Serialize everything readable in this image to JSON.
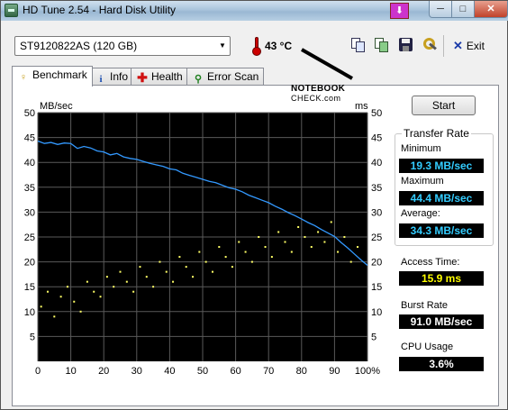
{
  "window": {
    "title": "HD Tune 2.54 - Hard Disk Utility",
    "min_glyph": "─",
    "max_glyph": "□",
    "close_glyph": "✕",
    "pin_glyph": "⬇"
  },
  "toolbar": {
    "drive": "ST9120822AS (120 GB)",
    "temperature": "43 °C",
    "exit_label": "Exit"
  },
  "watermark": {
    "line1": "NOTEBOOK",
    "line2": "CHECK.com"
  },
  "tabs": [
    {
      "label": "Benchmark",
      "icon": "benchmark-icon",
      "active": true
    },
    {
      "label": "Info",
      "icon": "info-icon"
    },
    {
      "label": "Health",
      "icon": "health-icon"
    },
    {
      "label": "Error Scan",
      "icon": "error-scan-icon"
    }
  ],
  "benchmark": {
    "start_label": "Start",
    "transfer_rate_label": "Transfer Rate",
    "minimum_label": "Minimum",
    "minimum": "19.3 MB/sec",
    "maximum_label": "Maximum",
    "maximum": "44.4 MB/sec",
    "average_label": "Average:",
    "average": "34.3 MB/sec",
    "access_time_label": "Access Time:",
    "access_time": "15.9 ms",
    "burst_rate_label": "Burst Rate",
    "burst_rate": "91.0 MB/sec",
    "cpu_usage_label": "CPU Usage",
    "cpu_usage": "3.6%"
  },
  "chart_data": {
    "type": "line",
    "ylabel": "MB/sec",
    "y2label": "ms",
    "xlim": [
      0,
      100
    ],
    "ylim": [
      0,
      50
    ],
    "y2lim": [
      0,
      50
    ],
    "x_ticks": [
      "0",
      "10",
      "20",
      "30",
      "40",
      "50",
      "60",
      "70",
      "80",
      "90",
      "100%"
    ],
    "y_ticks": [
      5,
      10,
      15,
      20,
      25,
      30,
      35,
      40,
      45,
      50
    ],
    "grid": true,
    "background": "#000000",
    "series": [
      {
        "type": "line",
        "color": "#3399ff",
        "x": [
          0,
          2,
          4,
          6,
          8,
          10,
          12,
          14,
          16,
          18,
          20,
          22,
          24,
          26,
          28,
          30,
          32,
          34,
          36,
          38,
          40,
          42,
          44,
          46,
          48,
          50,
          52,
          54,
          56,
          58,
          60,
          62,
          64,
          66,
          68,
          70,
          72,
          74,
          76,
          78,
          80,
          82,
          84,
          86,
          88,
          90,
          92,
          94,
          96,
          98,
          100
        ],
        "y": [
          44.3,
          43.8,
          44.0,
          43.6,
          43.9,
          43.8,
          42.8,
          43.2,
          42.9,
          42.3,
          42.1,
          41.5,
          41.8,
          41.1,
          40.8,
          40.6,
          40.2,
          39.8,
          39.5,
          39.2,
          38.7,
          38.5,
          37.8,
          37.4,
          37.0,
          36.6,
          36.2,
          35.9,
          35.4,
          34.9,
          34.6,
          34.1,
          33.4,
          32.9,
          32.4,
          31.9,
          31.2,
          30.6,
          29.9,
          29.3,
          28.6,
          27.9,
          27.3,
          26.5,
          25.8,
          25.1,
          23.9,
          22.8,
          21.6,
          20.4,
          19.3
        ]
      },
      {
        "type": "scatter",
        "color": "#ffff66",
        "axis": "y2",
        "x": [
          1,
          3,
          5,
          7,
          9,
          11,
          13,
          15,
          17,
          19,
          21,
          23,
          25,
          27,
          29,
          31,
          33,
          35,
          37,
          39,
          41,
          43,
          45,
          47,
          49,
          51,
          53,
          55,
          57,
          59,
          61,
          63,
          65,
          67,
          69,
          71,
          73,
          75,
          77,
          79,
          81,
          83,
          85,
          87,
          89,
          91,
          93,
          95,
          97
        ],
        "y": [
          11,
          14,
          9,
          13,
          15,
          12,
          10,
          16,
          14,
          13,
          17,
          15,
          18,
          16,
          14,
          19,
          17,
          15,
          20,
          18,
          16,
          21,
          19,
          17,
          22,
          20,
          18,
          23,
          21,
          19,
          24,
          22,
          20,
          25,
          23,
          21,
          26,
          24,
          22,
          27,
          25,
          23,
          26,
          24,
          28,
          22,
          25,
          20,
          23
        ]
      }
    ]
  }
}
